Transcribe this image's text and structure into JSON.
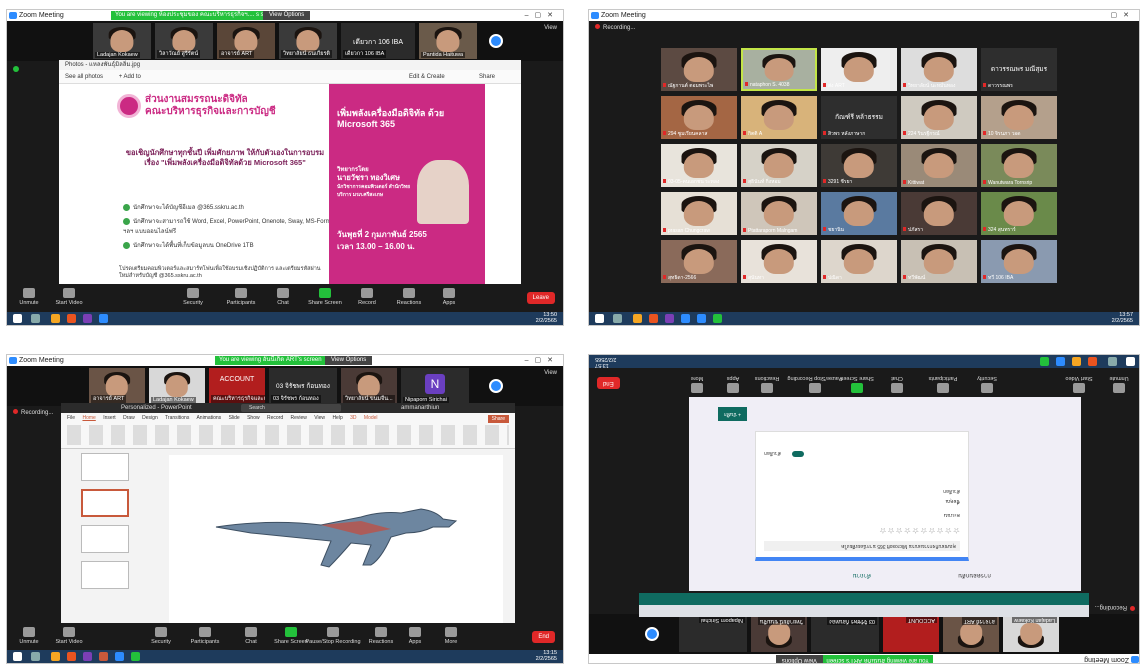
{
  "pane1": {
    "title": "Zoom Meeting",
    "viewing_banner": "You are viewing ห้องประชุมของ คณะบริหารธุรกิจฯ.... s screen",
    "view_options": "View Options",
    "view_label": "View",
    "participants": [
      {
        "name": "Ladajan Kokaew"
      },
      {
        "name": "วิลาวัณย์ สูรีรัตน์"
      },
      {
        "name": "อาจารย์ ART"
      },
      {
        "name": "วิทยาลัยน์ ธนเกียรติ"
      },
      {
        "name": "เดียวกา 106 IBA"
      },
      {
        "name": "Pantida Haituwa"
      }
    ],
    "big_tile_name": "เดียวกา 106 IBA",
    "photo_title": "Photos - แหลงพันธุ์มิลลิ่ม.jpg",
    "photo_toolbar": {
      "see_all": "See all photos",
      "add": "+ Add to",
      "edit": "Edit & Create",
      "share": "Share"
    },
    "poster": {
      "org_line1": "ส่วนงานสมรรถนะดิจิทัล",
      "org_line2": "คณะบริหารธุรกิจและการบัญชี",
      "invite": "ขอเชิญนักศึกษาทุกชั้นปี เพิ่มศักยภาพ ให้กับตัวเองในการอบรม เรื่อง \"เพิ่มพลังเครื่องมือดิจิทัลด้วย Microsoft 365\"",
      "bullets": [
        "นักศึกษาจะได้บัญชีอีเมล @365.sskru.ac.th",
        "นักศึกษาจะสามารถใช้ Word, Excel, PowerPoint, Onenote, Sway, MS-Form ฯลฯ แบบออนไลน์ฟรี",
        "นักศึกษาจะได้พื้นที่เก็บข้อมูลบน OneDrive 1TB"
      ],
      "footer": "โปรดเตรียมคอมพิวเตอร์และสมาร์ทโฟนเพื่อใช้อบรมเชิงปฏิบัติการ และเตรียมรหัสผ่านใหม่สำหรับบัญชี @365.sskru.ac.th",
      "right_title": "เพิ่มพลังเครื่องมือดิจิทัล ด้วย Microsoft 365",
      "speaker_label": "วิทยากรโดย",
      "speaker_name": "นายวัชรา ทองวิเศษ",
      "speaker_role": "นักวิชาการคอมพิวเตอร์ สำนักวิทยบริการ มรภ.ศรีสะเกษ",
      "date": "วันพุธที่ 2 กุมภาพันธ์ 2565",
      "time": "เวลา 13.00 – 16.00 น."
    },
    "controls": [
      "Unmute",
      "Start Video",
      "Security",
      "Participants",
      "Chat",
      "Share Screen",
      "Record",
      "Reactions",
      "Apps"
    ],
    "participant_count": "7",
    "leave": "Leave",
    "clock": "13:50",
    "date": "2/2/2565"
  },
  "pane2": {
    "title": "Zoom Meeting",
    "recording": "Recording...",
    "tiles": [
      {
        "name": "ณัฐกานต์ ตอมพระไพ"
      },
      {
        "name": "nataphon S. 4038"
      },
      {
        "name": "ส่ง ART"
      },
      {
        "name": "วิทยาลัยน์ นะหมั่นทอง"
      },
      {
        "name": "ดาวรรณพร"
      },
      {
        "name": "294 ซูมเรียนคลาส"
      },
      {
        "name": "กิตติ A"
      },
      {
        "name": "สิวพร หลังภาษาก"
      },
      {
        "name": "224 รินรฐีกรณ์"
      },
      {
        "name": "10 จิรนภา วอด"
      },
      {
        "name": "03-05-คนเอกชน ระทลง"
      },
      {
        "name": "สุธินันท์ กิ่งหอม"
      },
      {
        "name": "3291 ชีรยา"
      },
      {
        "name": "Kittiwat"
      },
      {
        "name": "Wanutwara Tornsrip"
      },
      {
        "name": "prasan Chungcraw"
      },
      {
        "name": "Ptattaraporn Malngam"
      },
      {
        "name": "ชยานิน"
      },
      {
        "name": "ปภัสรา"
      },
      {
        "name": "324 สุนทราร์"
      },
      {
        "name": "สุทธิดา-2566"
      },
      {
        "name": "สุนันทา"
      },
      {
        "name": "ปณิดา"
      },
      {
        "name": "ทวีพัฒน์"
      },
      {
        "name": "ทวี 106 IBA"
      }
    ],
    "big_names": [
      "ดาวรรณพร มณีสุมร",
      "กัณฑ์รี หล้าธรรม"
    ],
    "clock": "13:57",
    "date": "2/2/2565"
  },
  "pane3": {
    "title": "Zoom Meeting",
    "viewing_banner": "You are viewing อันนี้เกิด ART's screen",
    "view_options": "View Options",
    "view_label": "View",
    "participants": [
      {
        "name": "อาจารย์ ART"
      },
      {
        "name": "Ladajan Kokaew"
      },
      {
        "name": "คณะบริหารธุรกิจและการ..."
      },
      {
        "name": "03 จิรัชพร ก้อนทอง"
      },
      {
        "name": "วิทยาลัยน์ ขนมจีน..."
      },
      {
        "name": "Nipaporn Sirichai"
      }
    ],
    "account_tile": "ACCOUNT",
    "big_tile_name": "03 จิรัชพร ก้อนทอง",
    "ppt_title": "Personalized - PowerPoint",
    "ppt_search": "Search",
    "ppt_user": "ammanarthiun",
    "ribbon_tabs": [
      "File",
      "Home",
      "Insert",
      "Draw",
      "Design",
      "Transitions",
      "Animations",
      "Slide Show",
      "Record",
      "Review",
      "View",
      "Help",
      "3D Model"
    ],
    "share_btn": "Share",
    "recording": "Recording...",
    "controls": [
      "Unmute",
      "Start Video",
      "Security",
      "Participants",
      "Chat",
      "Share Screen",
      "Pause/Stop Recording",
      "Reactions",
      "Apps",
      "More"
    ],
    "participant_count": "16",
    "leave": "End",
    "clock": "13:15",
    "date": "2/2/2565"
  },
  "pane4": {
    "title": "Zoom Meeting",
    "viewing_banner": "You are viewing อันนี้เกิด ART's screen",
    "view_options": "View Options",
    "recording": "Recording...",
    "top_labels": [
      "Unmute",
      "Start Video",
      "Security",
      "Participants",
      "Chat",
      "Share Screen",
      "Pause/Stop Recording",
      "Reactions",
      "Apps",
      "More"
    ],
    "participants": [
      {
        "name": "Ladajan Kokaew"
      },
      {
        "name": "อาจารย์ ART"
      },
      {
        "name": "ACCOUNT"
      },
      {
        "name": "03 จิรัชพร ก้อนทอง"
      },
      {
        "name": "วิทยาลัยน์ ขนมจีน"
      },
      {
        "name": "Nipaporn Sirichai"
      }
    ],
    "form_button": "+ บันทึก",
    "form_toggle_label": "ตัวเลือก",
    "form_fields": [
      "ชื่อคุณ",
      "ตัวเลือก"
    ],
    "form_rating_label": "คะแนน",
    "form_stars": "☆☆☆☆☆☆☆☆☆☆",
    "form_question": "คุณชอบกิจกรรมอบรม Microsoft 365 มากน้อยเพียงใด",
    "tab_questions": "คำถาม",
    "tab_responses": "การตอบกลับ",
    "clock": "13:57",
    "date": "2/2/2565",
    "end": "End"
  }
}
